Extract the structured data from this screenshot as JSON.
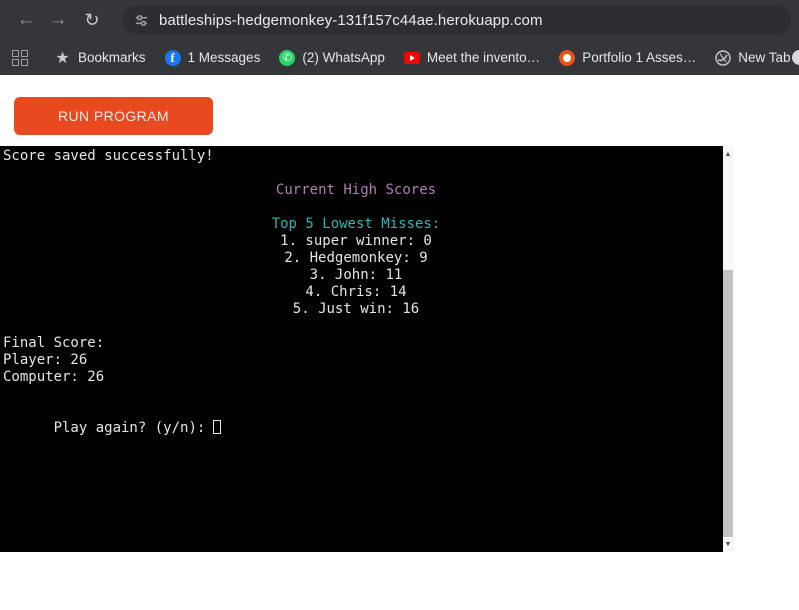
{
  "browser": {
    "url": "battleships-hedgemonkey-131f157c44ae.herokuapp.com",
    "nav_icons": {
      "back": "←",
      "forward": "→",
      "reload": "↻"
    },
    "bookmarks": [
      {
        "label": "Bookmarks"
      },
      {
        "label": "1 Messages"
      },
      {
        "label": "(2) WhatsApp"
      },
      {
        "label": "Meet the invento…"
      },
      {
        "label": "Portfolio 1 Asses…"
      },
      {
        "label": "New Tab"
      }
    ]
  },
  "icons": {
    "star": "★",
    "facebook_letter": "f",
    "whatsapp_phone": "✆",
    "scroll_up": "▲",
    "scroll_down": "▼"
  },
  "app": {
    "run_button_label": "RUN PROGRAM"
  },
  "terminal": {
    "lines": [
      {
        "text": "Score saved successfully!",
        "color": "white",
        "align": "left"
      },
      {
        "text": "Current High Scores",
        "color": "purple",
        "align": "center"
      },
      {
        "text": "Top 5 Lowest Misses:",
        "color": "cyan",
        "align": "center"
      },
      {
        "text": "1. super winner: 0",
        "color": "white",
        "align": "center"
      },
      {
        "text": "2. Hedgemonkey: 9",
        "color": "white",
        "align": "center"
      },
      {
        "text": "3. John: 11",
        "color": "white",
        "align": "center"
      },
      {
        "text": "4. Chris: 14",
        "color": "white",
        "align": "center"
      },
      {
        "text": "5. Just win: 16",
        "color": "white",
        "align": "center"
      },
      {
        "text": "Final Score:",
        "color": "white",
        "align": "left"
      },
      {
        "text": "Player: 26",
        "color": "white",
        "align": "left"
      },
      {
        "text": "Computer: 26",
        "color": "white",
        "align": "left"
      },
      {
        "text": "Play again? (y/n):",
        "color": "white",
        "align": "left",
        "has_cursor": true
      }
    ]
  },
  "colors": {
    "toolbar_bg": "#35363a",
    "accent_orange": "#e8491f",
    "terminal_purple": "#b57bb5",
    "terminal_cyan": "#2ab7ae",
    "facebook_blue": "#1877f2",
    "whatsapp_green": "#25d366",
    "youtube_red": "#ff0000"
  }
}
